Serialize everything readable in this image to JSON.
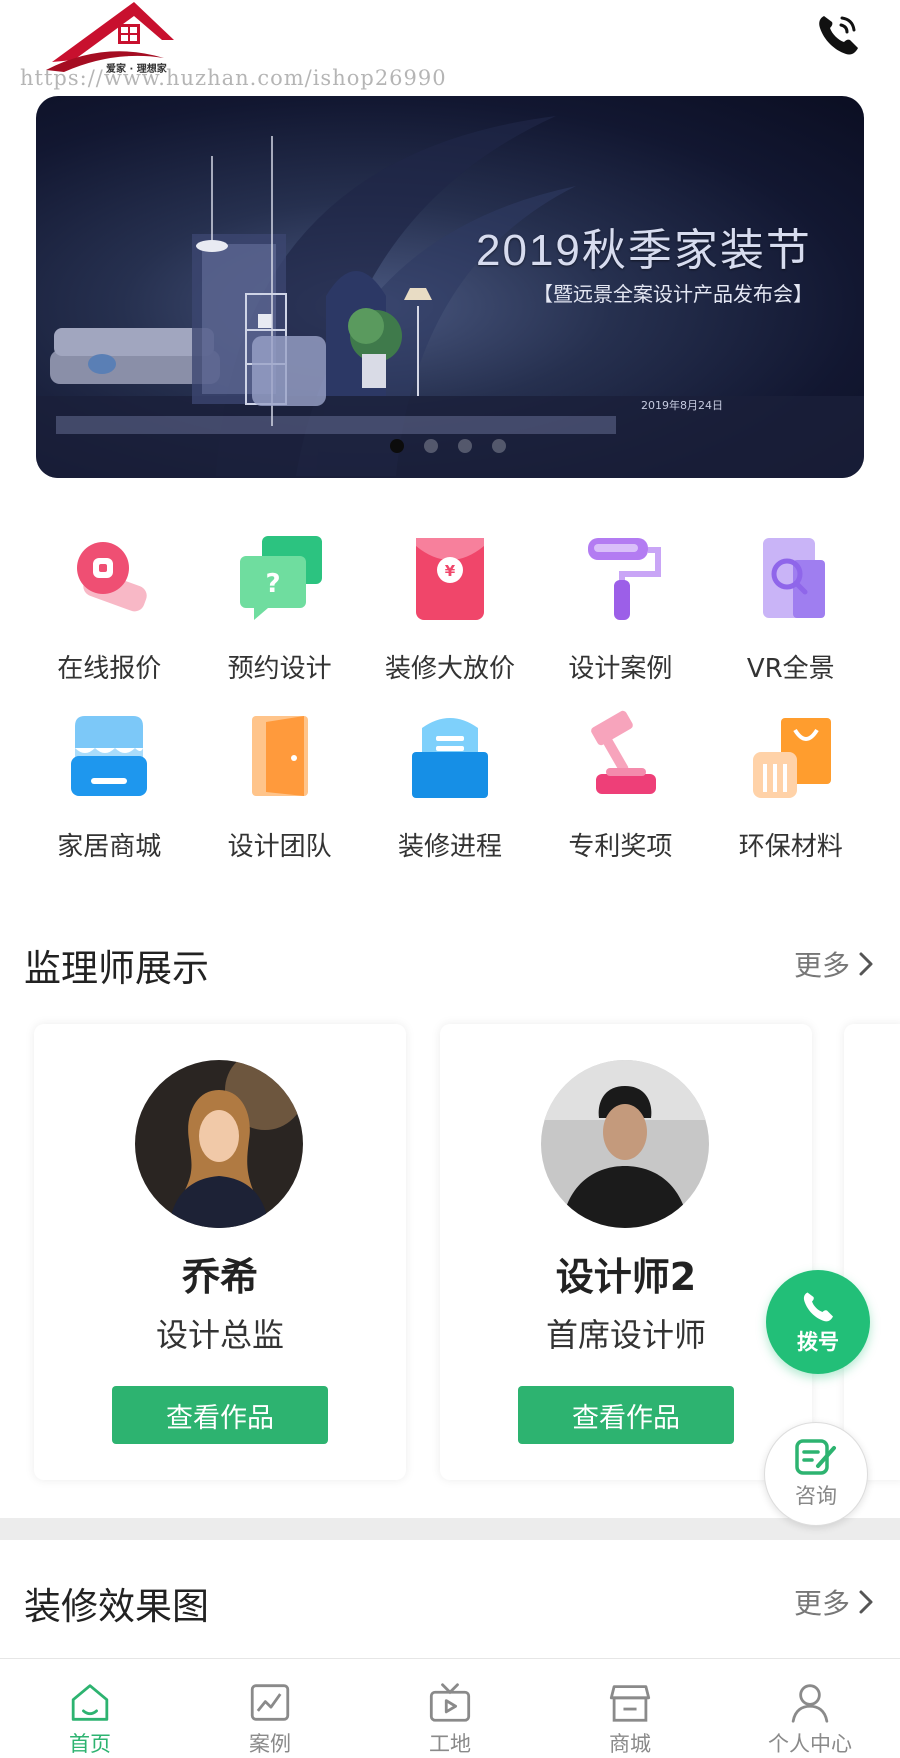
{
  "header": {
    "logo_text": "爱家 · 理想家",
    "watermark": "https://www.huzhan.com/ishop26990"
  },
  "banner": {
    "title": "2019秋季家装节",
    "subtitle": "【暨远景全案设计产品发布会】",
    "date": "2019年8月24日",
    "slide_count": 4,
    "active_slide": 1
  },
  "menu": {
    "row1": [
      {
        "label": "在线报价",
        "icon": "quote-icon"
      },
      {
        "label": "预约设计",
        "icon": "appointment-icon"
      },
      {
        "label": "装修大放价",
        "icon": "red-envelope-icon"
      },
      {
        "label": "设计案例",
        "icon": "paint-roller-icon"
      },
      {
        "label": "VR全景",
        "icon": "vr-search-icon"
      }
    ],
    "row2": [
      {
        "label": "家居商城",
        "icon": "shop-icon"
      },
      {
        "label": "设计团队",
        "icon": "door-icon"
      },
      {
        "label": "装修进程",
        "icon": "building-icon"
      },
      {
        "label": "专利奖项",
        "icon": "gavel-icon"
      },
      {
        "label": "环保材料",
        "icon": "shopping-bag-icon"
      }
    ]
  },
  "supervisors": {
    "title": "监理师展示",
    "more": "更多",
    "cards": [
      {
        "name": "乔希",
        "role": "设计总监",
        "button": "查看作品"
      },
      {
        "name": "设计师2",
        "role": "首席设计师",
        "button": "查看作品"
      }
    ]
  },
  "renderings": {
    "title": "装修效果图",
    "more": "更多"
  },
  "floating": {
    "call_label": "拨号",
    "consult_label": "咨询"
  },
  "tabbar": {
    "items": [
      {
        "label": "首页",
        "icon": "home-icon",
        "active": true
      },
      {
        "label": "案例",
        "icon": "case-icon",
        "active": false
      },
      {
        "label": "工地",
        "icon": "site-tv-icon",
        "active": false
      },
      {
        "label": "商城",
        "icon": "store-icon",
        "active": false
      },
      {
        "label": "个人中心",
        "icon": "user-icon",
        "active": false
      }
    ]
  },
  "colors": {
    "accent": "#2db370",
    "fab_green": "#22bf78",
    "text_primary": "#222222",
    "text_muted": "#777777"
  }
}
